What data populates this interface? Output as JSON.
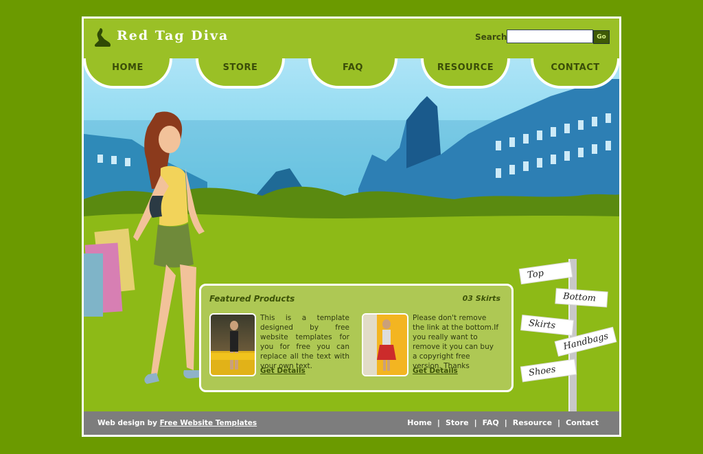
{
  "header": {
    "brand": "Red Tag Diva",
    "search_label": "Search:",
    "search_value": "",
    "search_button": "Go"
  },
  "nav": {
    "items": [
      "HOME",
      "STORE",
      "FAQ",
      "RESOURCE",
      "CONTACT"
    ]
  },
  "featured": {
    "title": "Featured Products",
    "count": "03 Skirts",
    "products": [
      {
        "text": "This is a template designed by free website templates for you for free you can replace all the text with your own text.",
        "link": "Get Details"
      },
      {
        "text": "Please don't remove the link at the bottom.If you really want to remove it you can buy a copyright free version. Thanks",
        "link": "Get Details"
      }
    ]
  },
  "signpost": {
    "signs": [
      "Top",
      "Bottom",
      "Skirts",
      "Handbags",
      "Shoes"
    ]
  },
  "footer": {
    "credit_prefix": "Web design by",
    "credit_link": "Free Website Templates",
    "links": [
      "Home",
      "Store",
      "FAQ",
      "Resource",
      "Contact"
    ],
    "separator": "|"
  },
  "colors": {
    "page_bg": "#6b9a00",
    "header_bg": "#9ac026",
    "footer_bg": "#7d7d7d",
    "panel_bg": "#aec854"
  }
}
